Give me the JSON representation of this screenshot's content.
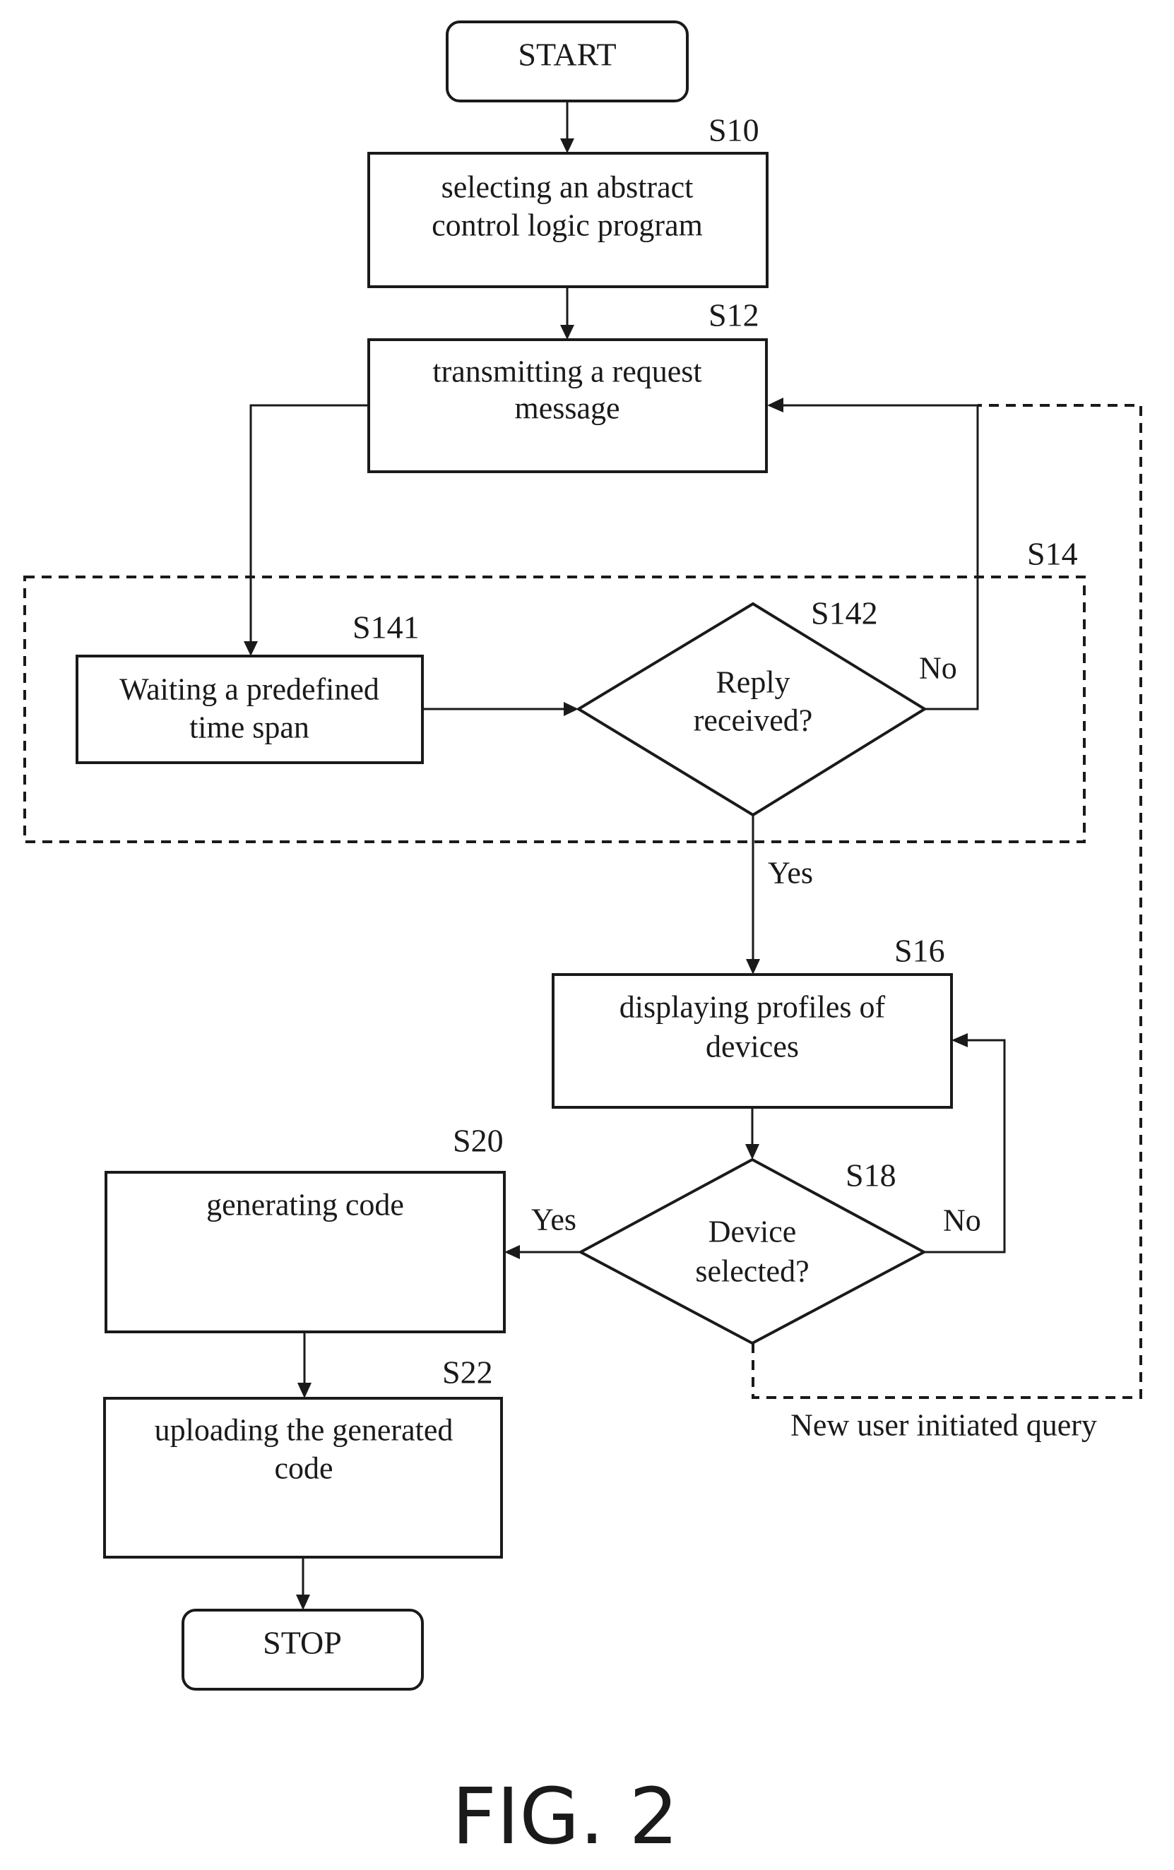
{
  "figure": {
    "caption": "FIG. 2",
    "nodes": {
      "start": {
        "label": "START"
      },
      "s10": {
        "step": "S10",
        "lines": [
          "selecting an abstract",
          "control logic program"
        ]
      },
      "s12": {
        "step": "S12",
        "lines": [
          "transmitting a request",
          "message"
        ]
      },
      "s14": {
        "step": "S14"
      },
      "s141": {
        "step": "S141",
        "lines": [
          "Waiting a predefined",
          "time span"
        ]
      },
      "s142": {
        "step": "S142",
        "lines": [
          "Reply",
          "received?"
        ]
      },
      "s16": {
        "step": "S16",
        "lines": [
          "displaying profiles of",
          "devices"
        ]
      },
      "s18": {
        "step": "S18",
        "lines": [
          "Device",
          "selected?"
        ]
      },
      "s20": {
        "step": "S20",
        "lines": [
          "generating code"
        ]
      },
      "s22": {
        "step": "S22",
        "lines": [
          "uploading the generated",
          "code"
        ]
      },
      "stop": {
        "label": "STOP"
      }
    },
    "edges": {
      "s142_no": "No",
      "s142_yes": "Yes",
      "s18_no": "No",
      "s18_yes": "Yes",
      "new_query": "New user initiated query"
    }
  }
}
